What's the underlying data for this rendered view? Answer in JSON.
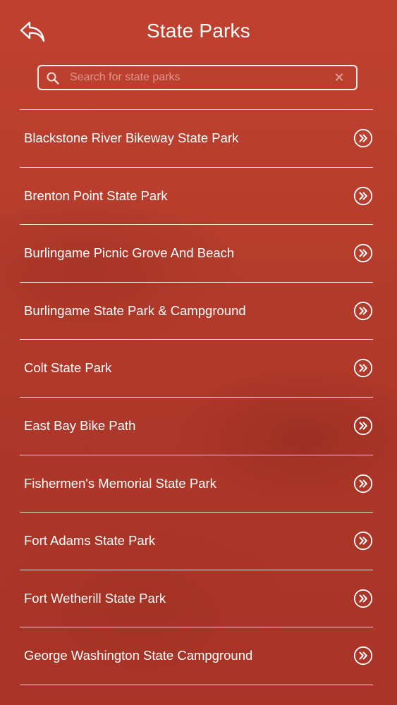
{
  "header": {
    "title": "State Parks"
  },
  "search": {
    "placeholder": "Search for state parks",
    "value": ""
  },
  "parks": [
    "Blackstone River Bikeway State Park",
    "Brenton Point State Park",
    "Burlingame Picnic Grove And Beach",
    "Burlingame State Park & Campground",
    "Colt State Park",
    "East Bay Bike Path",
    "Fishermen's Memorial State Park",
    "Fort Adams State Park",
    "Fort Wetherill State Park",
    "George Washington State Campground"
  ],
  "icons": {
    "back": "reply-arrow-icon",
    "search": "search-icon",
    "clear": "close-icon",
    "row": "double-chevron-right-circle-icon"
  },
  "colors": {
    "background": "#b63b2b",
    "foreground": "#ffffff"
  }
}
